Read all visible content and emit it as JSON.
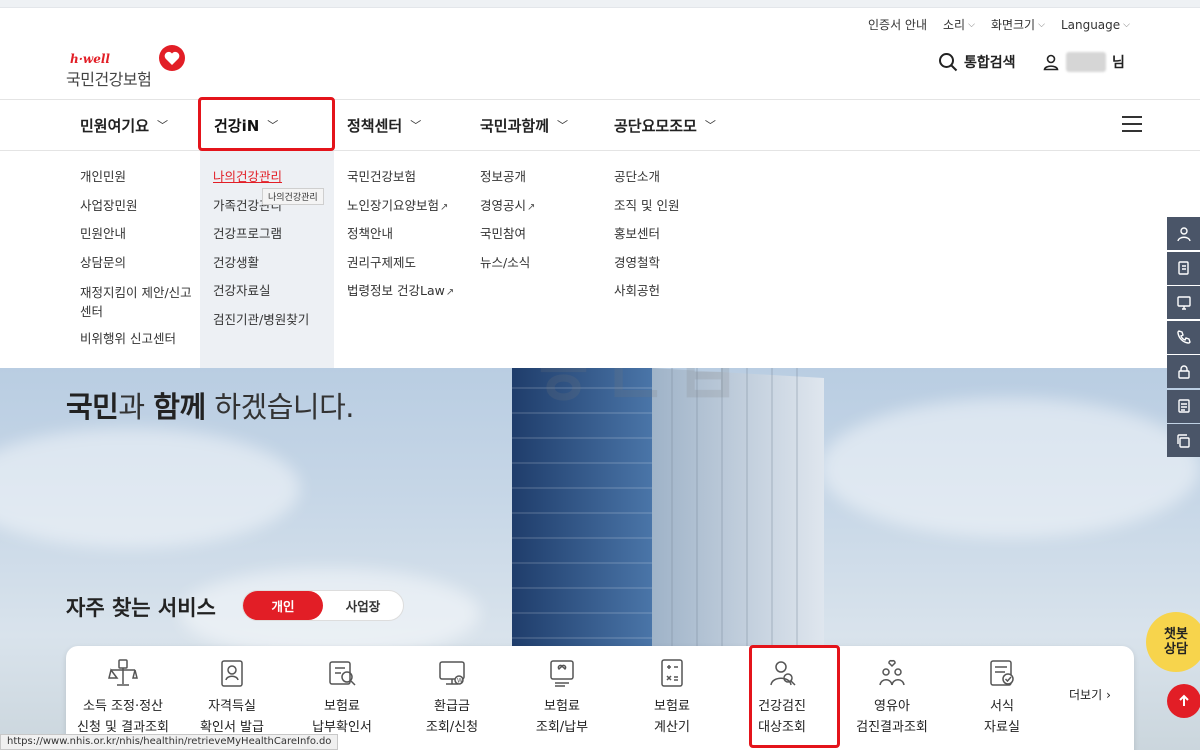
{
  "util_bar": {
    "items": [
      {
        "label": "인증서 안내",
        "has_caret": false
      },
      {
        "label": "소리",
        "has_caret": true
      },
      {
        "label": "화면크기",
        "has_caret": true
      },
      {
        "label": "Language",
        "has_caret": true
      }
    ]
  },
  "logo": {
    "tagline": "h·well",
    "name": "국민건강보험"
  },
  "header": {
    "search_label": "통합검색",
    "user_suffix": "님"
  },
  "gnb": [
    {
      "label": "민원여기요"
    },
    {
      "label": "건강iN"
    },
    {
      "label": "정책센터"
    },
    {
      "label": "국민과함께"
    },
    {
      "label": "공단요모조모"
    }
  ],
  "mega": {
    "col1": [
      "개인민원",
      "사업장민원",
      "민원안내",
      "상담문의",
      "재정지킴이 제안/신고센터",
      "비위행위 신고센터"
    ],
    "col2": [
      "나의건강관리",
      "가족건강관리",
      "건강프로그램",
      "건강생활",
      "건강자료실",
      "검진기관/병원찾기"
    ],
    "col3": [
      "국민건강보험",
      "노인장기요양보험",
      "정책안내",
      "권리구제제도",
      "법령정보 건강Law"
    ],
    "col4": [
      "정보공개",
      "경영공시",
      "국민참여",
      "뉴스/소식"
    ],
    "col5": [
      "공단소개",
      "조직 및 인원",
      "홍보센터",
      "경영철학",
      "사회공헌"
    ],
    "tooltip": "나의건강관리"
  },
  "hero": {
    "title_bold1": "국민",
    "title_mid": "과 ",
    "title_bold2": "함께",
    "title_end": " 하겠습니다."
  },
  "services": {
    "title": "자주 찾는 서비스",
    "toggle_on": "개인",
    "toggle_off": "사업장",
    "more": "더보기",
    "items": [
      {
        "l1": "소득 조정·정산",
        "l2": "신청 및 결과조회",
        "icon": "scale-icon"
      },
      {
        "l1": "자격득실",
        "l2": "확인서 발급",
        "icon": "certificate-icon"
      },
      {
        "l1": "보험료",
        "l2": "납부확인서",
        "icon": "payment-confirm-icon"
      },
      {
        "l1": "환급금",
        "l2": "조회/신청",
        "icon": "refund-icon"
      },
      {
        "l1": "보험료",
        "l2": "조회/납부",
        "icon": "premium-pay-icon"
      },
      {
        "l1": "보험료",
        "l2": "계산기",
        "icon": "calculator-icon"
      },
      {
        "l1": "건강검진",
        "l2": "대상조회",
        "icon": "checkup-target-icon"
      },
      {
        "l1": "영유아",
        "l2": "검진결과조회",
        "icon": "infant-icon"
      },
      {
        "l1": "서식",
        "l2": "자료실",
        "icon": "forms-icon"
      }
    ]
  },
  "chatbot": {
    "label1": "챗봇",
    "label2": "상담"
  },
  "status_url": "https://www.nhis.or.kr/nhis/healthin/retrieveMyHealthCareInfo.do"
}
